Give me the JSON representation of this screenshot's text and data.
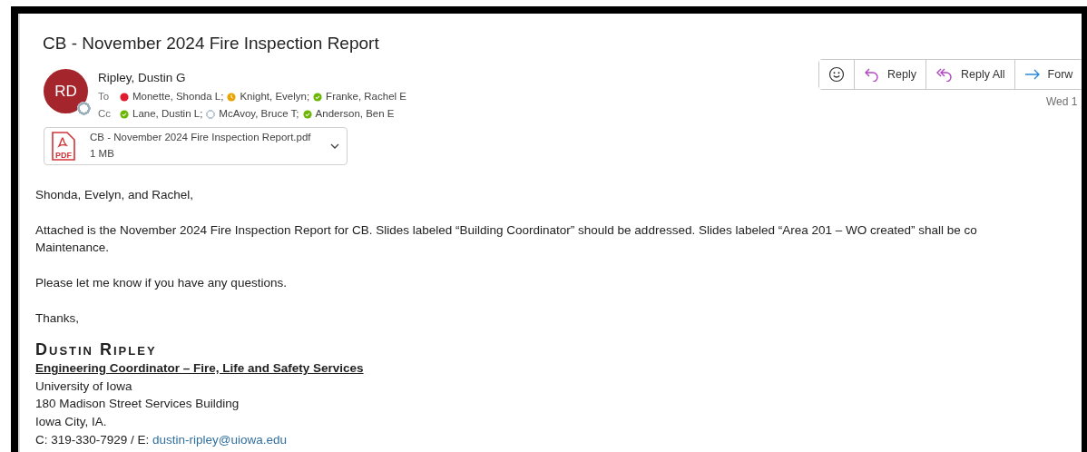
{
  "subject": "CB - November 2024 Fire Inspection Report",
  "sender": {
    "initials": "RD",
    "name": "Ripley, Dustin G",
    "presence": {
      "kind": "ring",
      "color": "#9bb0bd"
    }
  },
  "to_label": "To",
  "to": [
    {
      "name": "Monette, Shonda L;",
      "presence": {
        "kind": "dot",
        "color": "#e01b2f"
      }
    },
    {
      "name": "Knight, Evelyn;",
      "presence": {
        "kind": "clock",
        "color": "#eaa300"
      }
    },
    {
      "name": "Franke, Rachel E",
      "presence": {
        "kind": "check",
        "color": "#6bb700"
      }
    }
  ],
  "cc_label": "Cc",
  "cc": [
    {
      "name": "Lane, Dustin L;",
      "presence": {
        "kind": "check",
        "color": "#6bb700"
      }
    },
    {
      "name": "McAvoy, Bruce T;",
      "presence": {
        "kind": "ring",
        "color": "#bccbd3"
      }
    },
    {
      "name": "Anderson, Ben E",
      "presence": {
        "kind": "check",
        "color": "#6bb700"
      }
    }
  ],
  "attachment": {
    "name": "CB - November 2024 Fire Inspection Report.pdf",
    "size": "1 MB",
    "type_label": "PDF"
  },
  "actions": [
    {
      "kind": "emoji"
    },
    {
      "kind": "reply",
      "label": "Reply"
    },
    {
      "kind": "reply_all",
      "label": "Reply All"
    },
    {
      "kind": "forward",
      "label": "Forw"
    }
  ],
  "date": "Wed 1",
  "body": [
    [
      "Shonda, Evelyn, and Rachel,"
    ],
    [
      "Attached is the November 2024 Fire Inspection Report for CB.  Slides labeled “Building Coordinator” should be addressed.  Slides labeled “Area 201 – WO created” shall be co",
      "Maintenance."
    ],
    [
      "Please let me know if you have any questions."
    ],
    [
      "Thanks,"
    ]
  ],
  "signature": {
    "name": "Dustin Ripley",
    "title": "Engineering Coordinator – Fire, Life and Safety Services",
    "lines": [
      "University of Iowa",
      "180 Madison Street Services Building",
      "Iowa City, IA."
    ],
    "contact_prefix": "C: 319-330-7929 / E: ",
    "email": "dustin-ripley@uiowa.edu"
  }
}
